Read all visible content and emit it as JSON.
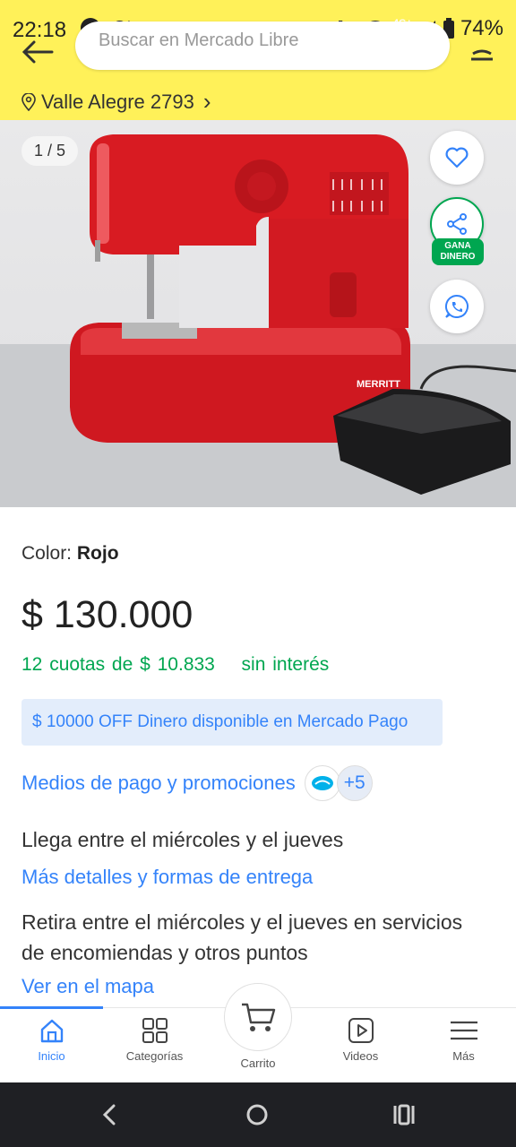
{
  "status_bar": {
    "time": "22:18",
    "carrier_glyph": "Ct",
    "network": "4G+",
    "battery": "74%"
  },
  "header": {
    "search_placeholder": "Buscar en Mercado Libre",
    "location": "Valle Alegre 2793",
    "location_chevron": "›"
  },
  "gallery": {
    "counter": "1 / 5",
    "gana_dinero": "GANA DINERO",
    "watermark_brand": "MERRITT",
    "current_index": 1,
    "total": 5
  },
  "product": {
    "color_label": "Color:",
    "color_value": "Rojo",
    "price": "$ 130.000",
    "cuotas_prefix": "12 cuotas de",
    "cuotas_value": "$ 10.833",
    "cuotas_suffix": "sin interés",
    "promo": "$ 10000 OFF Dinero disponible en Mercado Pago",
    "medios": "Medios de pago y promociones",
    "medios_more": "+5"
  },
  "delivery": {
    "llega": "Llega entre el miércoles y el jueves",
    "mas_detalles": "Más detalles y formas de entrega",
    "retira": "Retira entre el miércoles y el jueves en servicios de encomiendas y otros puntos",
    "ver_mapa": "Ver en el mapa"
  },
  "bottom_nav": {
    "items": [
      {
        "label": "Inicio",
        "icon": "home-icon",
        "active": true
      },
      {
        "label": "Categorías",
        "icon": "grid-icon",
        "active": false
      },
      {
        "label": "Carrito",
        "icon": "cart-icon",
        "active": false
      },
      {
        "label": "Videos",
        "icon": "play-icon",
        "active": false
      },
      {
        "label": "Más",
        "icon": "menu-icon",
        "active": false
      }
    ]
  },
  "colors": {
    "brand_yellow": "#fff159",
    "link_blue": "#3483fa",
    "green": "#00a650",
    "product_red": "#d81b22"
  }
}
